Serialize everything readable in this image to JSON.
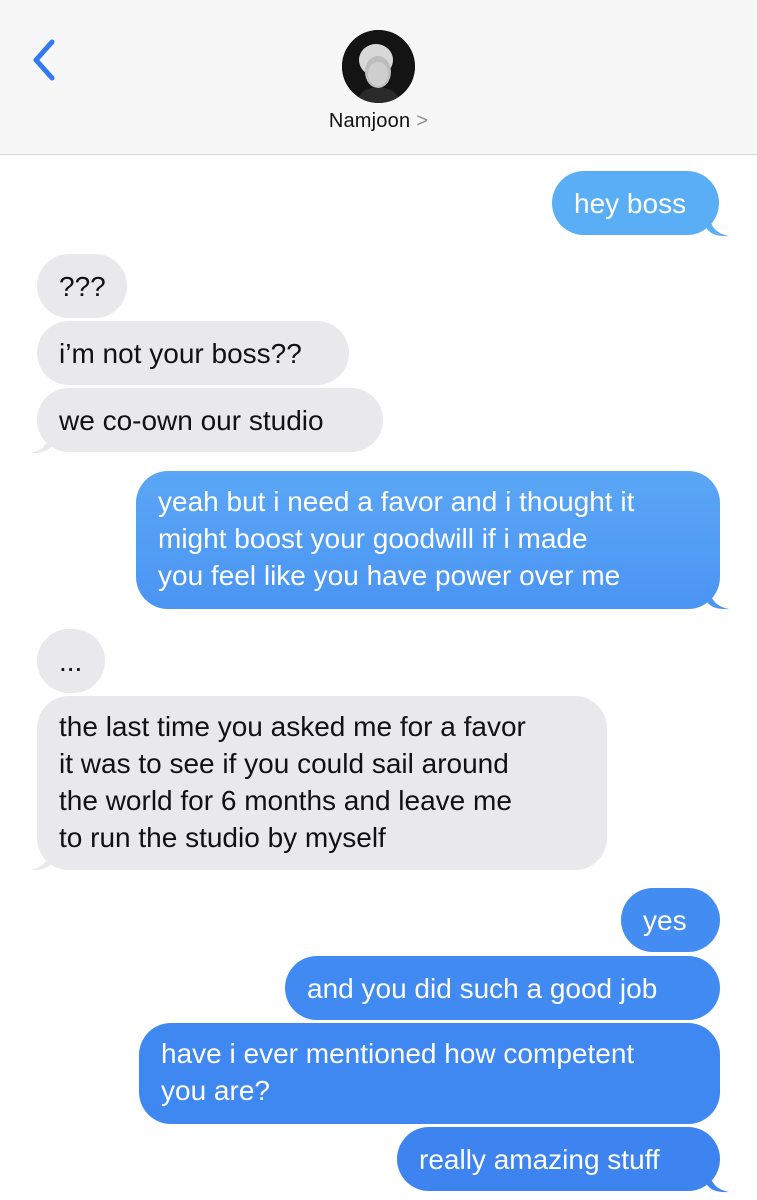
{
  "header": {
    "contact_name": "Namjoon",
    "chevron": ">",
    "back_icon": "chevron-left-icon",
    "accent": "#3478f6"
  },
  "colors": {
    "outgoing_top": "#5aaef6",
    "outgoing_bottom": "#3d82f0",
    "incoming": "#e9e9eb"
  },
  "messages": [
    {
      "from": "me",
      "text": "hey boss"
    },
    {
      "from": "them",
      "text": "???"
    },
    {
      "from": "them",
      "text": "i’m not your boss??"
    },
    {
      "from": "them",
      "text": "we co-own our studio"
    },
    {
      "from": "me",
      "lines": [
        "yeah but i need a favor and i thought it",
        "might boost your goodwill if i made",
        "you feel like you have power over me"
      ]
    },
    {
      "from": "them",
      "text": "..."
    },
    {
      "from": "them",
      "lines": [
        "the last time you asked me for a favor",
        "it was to see if you could sail around",
        "the world for 6 months and leave me",
        "to run the studio by myself"
      ]
    },
    {
      "from": "me",
      "text": "yes"
    },
    {
      "from": "me",
      "text": "and you did such a good job"
    },
    {
      "from": "me",
      "lines": [
        "have i ever mentioned how competent",
        "you are?"
      ]
    },
    {
      "from": "me",
      "text": "really amazing stuff"
    }
  ]
}
